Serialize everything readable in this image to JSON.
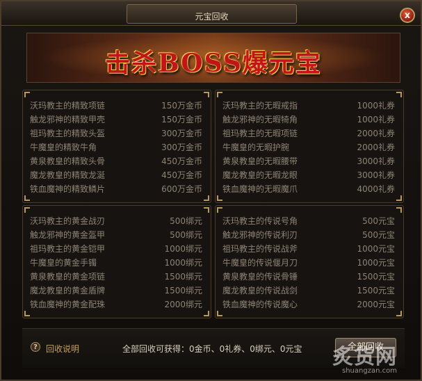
{
  "window": {
    "title": "元宝回收",
    "close_label": "x"
  },
  "banner": {
    "text": "击杀BOSS爆元宝"
  },
  "panels": [
    {
      "items": [
        {
          "name": "沃玛教主的精致项链",
          "value": "150万金币"
        },
        {
          "name": "触龙邪神的精致甲壳",
          "value": "150万金币"
        },
        {
          "name": "祖玛教主的精致头盔",
          "value": "300万金币"
        },
        {
          "name": "牛魔皇的精致牛角",
          "value": "300万金币"
        },
        {
          "name": "黄泉教皇的精致头骨",
          "value": "450万金币"
        },
        {
          "name": "魔龙教皇的精致龙涎",
          "value": "450万金币"
        },
        {
          "name": "铁血魔神的精致鳞片",
          "value": "600万金币"
        }
      ]
    },
    {
      "items": [
        {
          "name": "沃玛教主的无暇戒指",
          "value": "1000礼券"
        },
        {
          "name": "触龙邪神的无暇犄角",
          "value": "1000礼券"
        },
        {
          "name": "祖玛教主的无暇项链",
          "value": "2000礼券"
        },
        {
          "name": "牛魔皇的无暇护腕",
          "value": "2000礼券"
        },
        {
          "name": "黄泉教皇的无暇腰带",
          "value": "3000礼券"
        },
        {
          "name": "魔龙教皇的无暇龙眼",
          "value": "3000礼券"
        },
        {
          "name": "铁血魔神的无暇魔爪",
          "value": "4000礼券"
        }
      ]
    },
    {
      "items": [
        {
          "name": "沃玛教主的黄金战刃",
          "value": "500绑元"
        },
        {
          "name": "触龙邪神的黄金盔甲",
          "value": "500绑元"
        },
        {
          "name": "祖玛教主的黄金铠甲",
          "value": "1000绑元"
        },
        {
          "name": "牛魔皇的黄金手镯",
          "value": "1000绑元"
        },
        {
          "name": "黄泉教皇的黄金项链",
          "value": "1500绑元"
        },
        {
          "name": "魔龙教皇的黄金盾牌",
          "value": "1500绑元"
        },
        {
          "name": "铁血魔神的黄金配珠",
          "value": "2000绑元"
        }
      ]
    },
    {
      "items": [
        {
          "name": "沃玛教主的传说号角",
          "value": "500元宝"
        },
        {
          "name": "触龙邪神的传说利刃",
          "value": "500元宝"
        },
        {
          "name": "祖玛教主的传说战斧",
          "value": "1000元宝"
        },
        {
          "name": "牛魔皇的传说偃月刀",
          "value": "1000元宝"
        },
        {
          "name": "黄泉教皇的传说骨锤",
          "value": "1500元宝"
        },
        {
          "name": "魔龙教皇的传说战剑",
          "value": "1500元宝"
        },
        {
          "name": "铁血魔神的传说魔心",
          "value": "2000元宝"
        }
      ]
    }
  ],
  "footer": {
    "help_icon": "?",
    "help_label": "回收说明",
    "total_label": "全部回收可获得：0金币、0礼券、0绑元、0元宝",
    "recycle_button": "全部回收"
  },
  "watermark": {
    "main": "炙货网",
    "sub": "shuangzan.com"
  }
}
